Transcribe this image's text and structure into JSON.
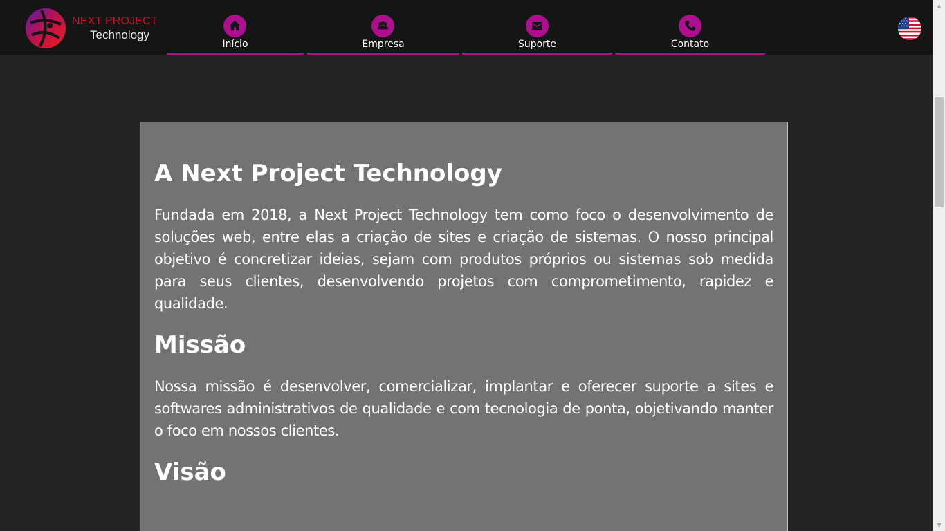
{
  "brand": {
    "line1": "NEXT PROJECT",
    "line2": "Technology",
    "primary_color": "#ae0f8e",
    "logo_red": "#d0102a"
  },
  "nav": {
    "items": [
      {
        "label": "Início",
        "icon": "home-icon"
      },
      {
        "label": "Empresa",
        "icon": "people-icon"
      },
      {
        "label": "Suporte",
        "icon": "envelope-icon"
      },
      {
        "label": "Contato",
        "icon": "phone-icon"
      }
    ],
    "language_icon": "us-flag-icon"
  },
  "content": {
    "title": "A Next Project Technology",
    "intro": "Fundada em 2018, a Next Project Technology tem como foco o desenvolvimento de soluções web, entre elas a criação de sites e criação de sistemas. O nosso principal objetivo é concretizar ideias, sejam com produtos próprios ou sistemas sob medida para seus clientes, desenvolvendo projetos com comprometimento, rapidez e qualidade.",
    "mission_title": "Missão",
    "mission_text": "Nossa missão é desenvolver, comercializar, implantar e oferecer suporte a sites e softwares administrativos de qualidade e com tecnologia de ponta, objetivando manter o foco em nossos clientes.",
    "vision_title": "Visão"
  }
}
